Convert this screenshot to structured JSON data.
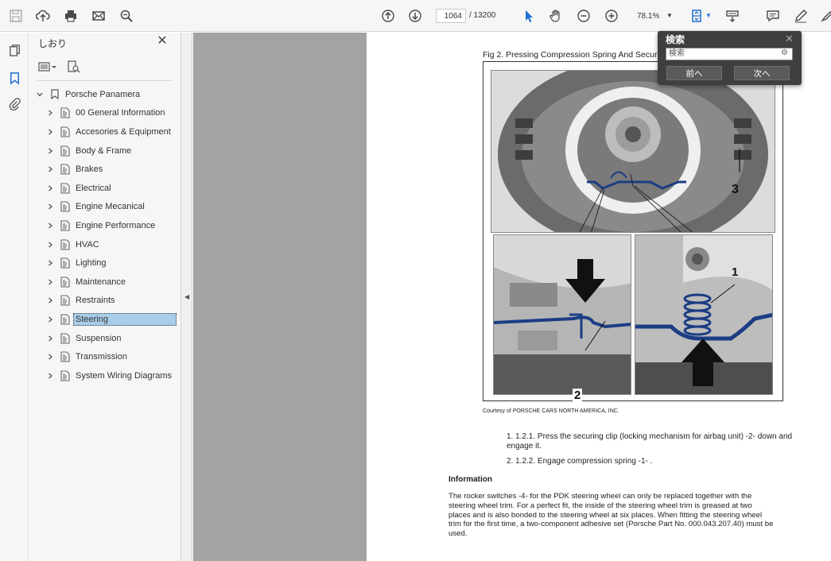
{
  "toolbar": {
    "page_current": "1064",
    "page_total": "/ 13200",
    "zoom": "78.1%"
  },
  "bookmarks_panel": {
    "title": "しおり",
    "items": [
      {
        "label": "Porsche Panamera",
        "level": 0,
        "expanded": true
      },
      {
        "label": "00 General Information",
        "level": 1
      },
      {
        "label": "Accesories & Equipment",
        "level": 1
      },
      {
        "label": "Body & Frame",
        "level": 1
      },
      {
        "label": "Brakes",
        "level": 1
      },
      {
        "label": "Electrical",
        "level": 1
      },
      {
        "label": "Engine Mecanical",
        "level": 1
      },
      {
        "label": "Engine Performance",
        "level": 1
      },
      {
        "label": "HVAC",
        "level": 1
      },
      {
        "label": "Lighting",
        "level": 1
      },
      {
        "label": "Maintenance",
        "level": 1
      },
      {
        "label": "Restraints",
        "level": 1
      },
      {
        "label": "Steering",
        "level": 1,
        "selected": true
      },
      {
        "label": "Suspension",
        "level": 1
      },
      {
        "label": "Transmission",
        "level": 1
      },
      {
        "label": "System Wiring Diagrams",
        "level": 1
      }
    ]
  },
  "document": {
    "figure_caption": "Fig 2. Pressing Compression Spring And Securing",
    "callouts": [
      "1",
      "2",
      "3"
    ],
    "courtesy": "Courtesy of PORSCHE CARS NORTH AMERICA, INC.",
    "steps": [
      "1. 1.2.1. Press the securing clip (locking mechanism for airbag unit) -2- down and engage it.",
      "2. 1.2.2. Engage compression spring -1- ."
    ],
    "info_heading": "Information",
    "info_text": "The rocker switches -4- for the PDK steering wheel can only be replaced together with the steering wheel trim. For a perfect fit, the inside of the steering wheel trim is greased at two places and is also bonded to the steering wheel at six places. When fitting the steering wheel trim for the first time, a two-component adhesive set (Porsche Part No. 000.043.207.40) must be used."
  },
  "search_popup": {
    "title": "検索",
    "input_value": "検索",
    "prev_label": "前へ",
    "next_label": "次へ"
  }
}
